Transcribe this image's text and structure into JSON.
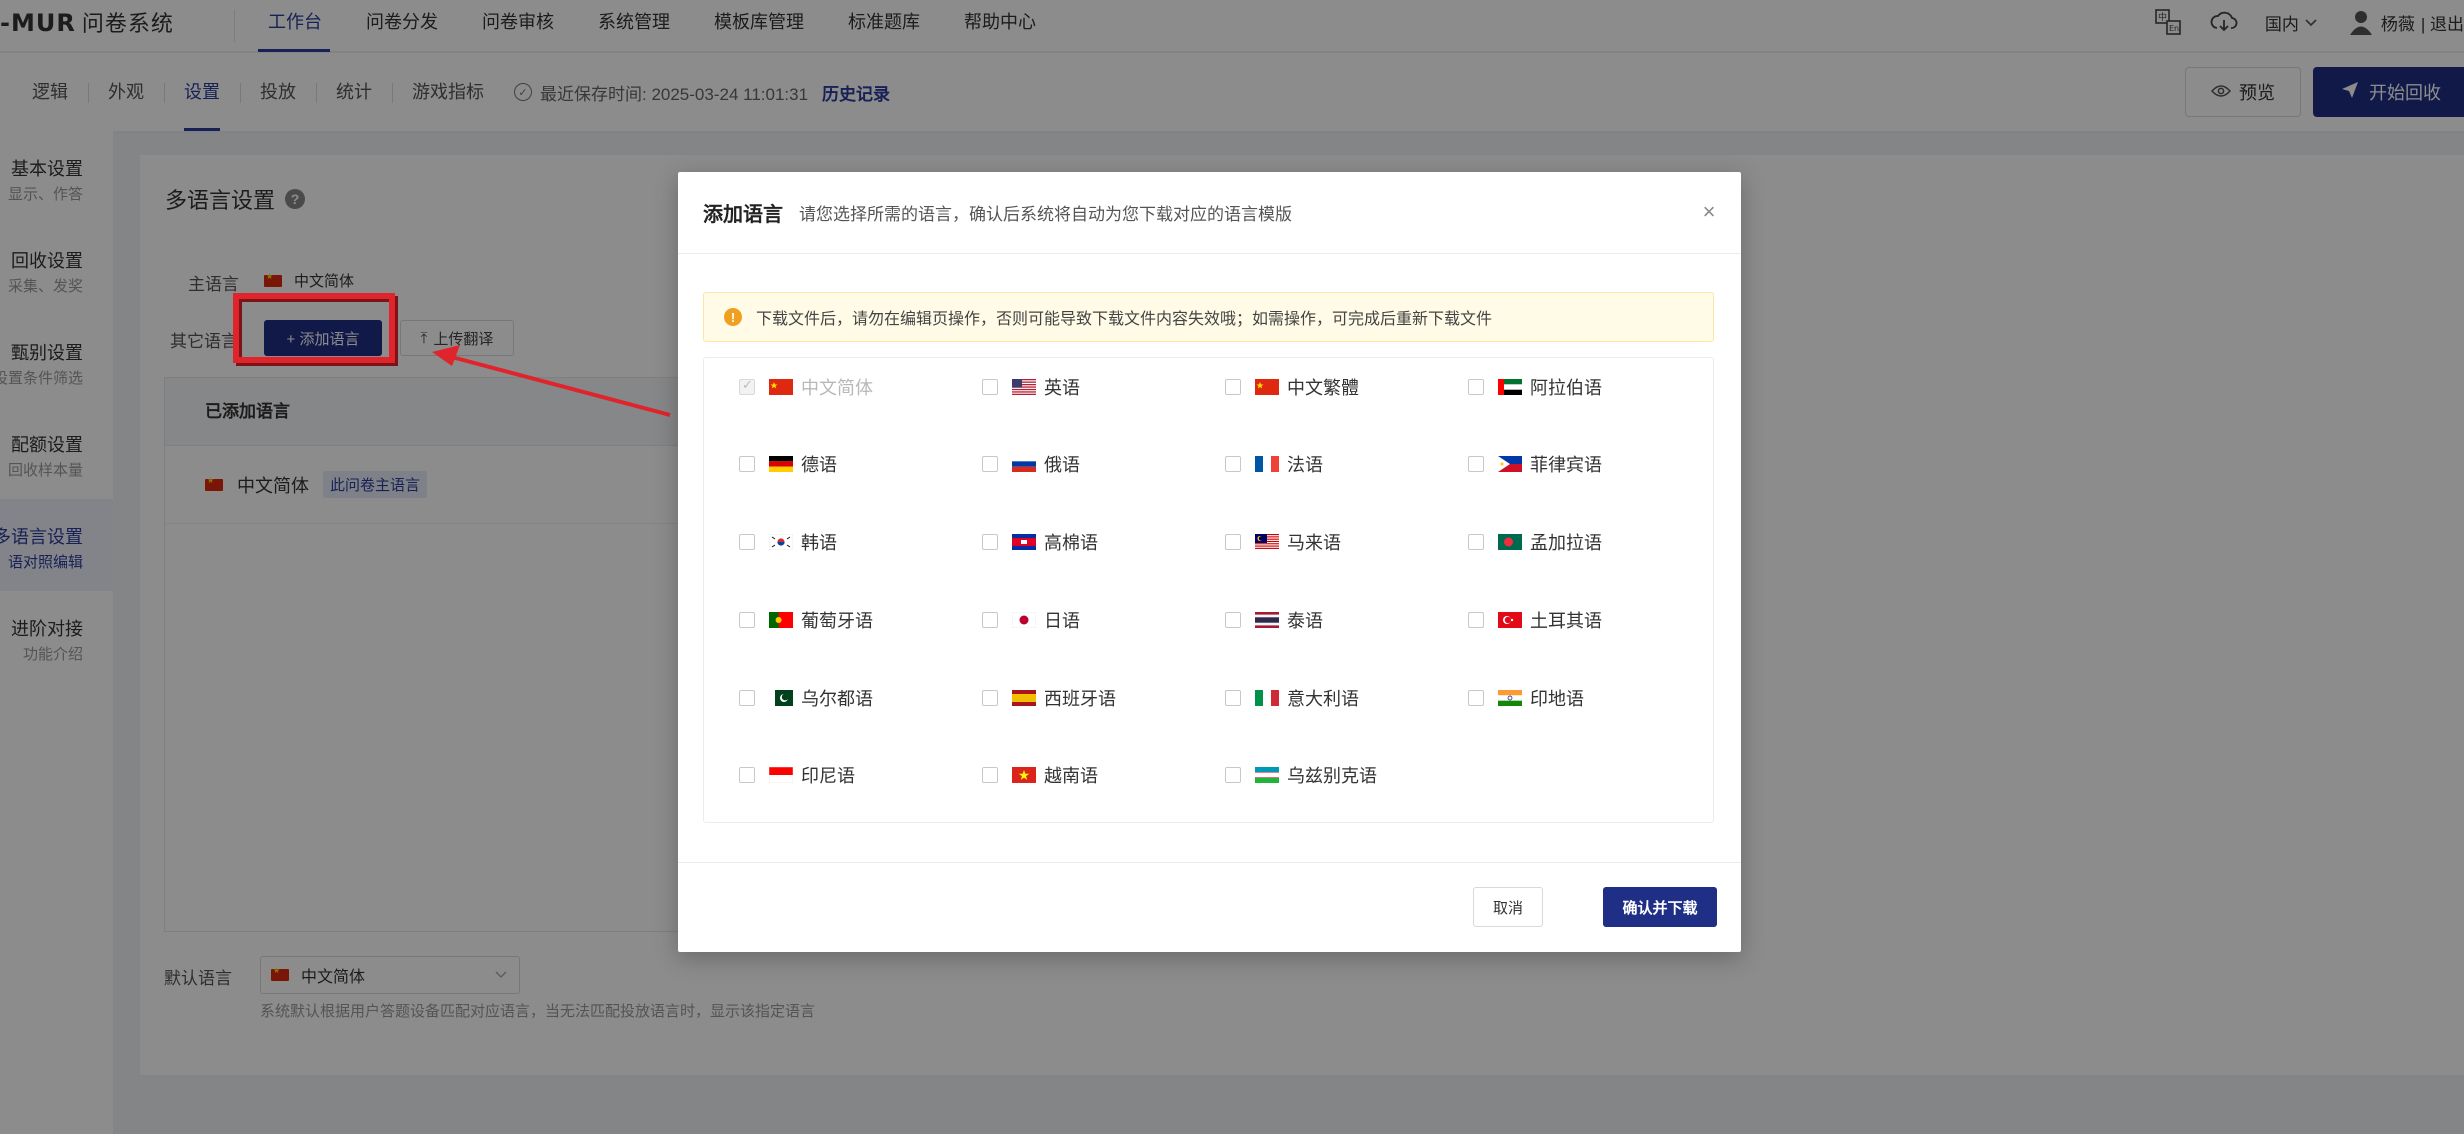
{
  "app": {
    "logo_mark": "-MUR",
    "logo_name": "问卷系统"
  },
  "topnav": {
    "items": [
      {
        "label": "工作台",
        "active": true
      },
      {
        "label": "问卷分发"
      },
      {
        "label": "问卷审核"
      },
      {
        "label": "系统管理"
      },
      {
        "label": "模板库管理"
      },
      {
        "label": "标准题库"
      },
      {
        "label": "帮助中心"
      }
    ],
    "region": "国内",
    "user_name": "杨薇",
    "logout": "| 退出"
  },
  "subbar": {
    "tabs": [
      {
        "label": "逻辑"
      },
      {
        "label": "外观"
      },
      {
        "label": "设置",
        "active": true
      },
      {
        "label": "投放"
      },
      {
        "label": "统计"
      },
      {
        "label": "游戏指标"
      }
    ],
    "save_text": "最近保存时间: 2025-03-24 11:01:31",
    "history_label": "历史记录",
    "preview_label": "预览",
    "start_label": "开始回收"
  },
  "sidebar": {
    "items": [
      {
        "title": "基本设置",
        "sub": "显示、作答"
      },
      {
        "title": "回收设置",
        "sub": "采集、发奖"
      },
      {
        "title": "甄别设置",
        "sub": "设置条件筛选"
      },
      {
        "title": "配额设置",
        "sub": "回收样本量"
      },
      {
        "title": "多语言设置",
        "sub": "语对照编辑",
        "active": true
      },
      {
        "title": "进阶对接",
        "sub": "功能介绍"
      }
    ]
  },
  "content": {
    "title": "多语言设置",
    "main_lang_label": "主语言",
    "main_lang_value": "中文简体",
    "other_lang_label": "其它语言",
    "add_button": "+ 添加语言",
    "upload_button": "上传翻译",
    "table_header": "已添加语言",
    "added_lang": "中文简体",
    "added_lang_tag": "此问卷主语言",
    "default_lang_label": "默认语言",
    "default_lang_value": "中文简体",
    "hint": "系统默认根据用户答题设备匹配对应语言，当无法匹配投放语言时，显示该指定语言"
  },
  "modal": {
    "title": "添加语言",
    "subtitle": "请您选择所需的语言，确认后系统将自动为您下载对应的语言模版",
    "alert": "下载文件后，请勿在编辑页操作，否则可能导致下载文件内容失效哦；如需操作，可完成后重新下载文件",
    "cancel": "取消",
    "confirm": "确认并下载",
    "languages": [
      {
        "label": "中文简体",
        "flag": "cn",
        "checked": true,
        "disabled": true
      },
      {
        "label": "英语",
        "flag": "us"
      },
      {
        "label": "中文繁體",
        "flag": "cn"
      },
      {
        "label": "阿拉伯语",
        "flag": "ae"
      },
      {
        "label": "德语",
        "flag": "de"
      },
      {
        "label": "俄语",
        "flag": "ru"
      },
      {
        "label": "法语",
        "flag": "fr"
      },
      {
        "label": "菲律宾语",
        "flag": "ph"
      },
      {
        "label": "韩语",
        "flag": "kr"
      },
      {
        "label": "高棉语",
        "flag": "kh"
      },
      {
        "label": "马来语",
        "flag": "my"
      },
      {
        "label": "孟加拉语",
        "flag": "bd"
      },
      {
        "label": "葡萄牙语",
        "flag": "pt"
      },
      {
        "label": "日语",
        "flag": "jp"
      },
      {
        "label": "泰语",
        "flag": "th"
      },
      {
        "label": "土耳其语",
        "flag": "tr"
      },
      {
        "label": "乌尔都语",
        "flag": "pk"
      },
      {
        "label": "西班牙语",
        "flag": "es"
      },
      {
        "label": "意大利语",
        "flag": "it"
      },
      {
        "label": "印地语",
        "flag": "in"
      },
      {
        "label": "印尼语",
        "flag": "id"
      },
      {
        "label": "越南语",
        "flag": "vn"
      },
      {
        "label": "乌兹别克语",
        "flag": "uz"
      }
    ]
  },
  "colors": {
    "brand": "#1f2f86",
    "accent_text": "#2c3d9b",
    "highlight": "#e0242b"
  }
}
